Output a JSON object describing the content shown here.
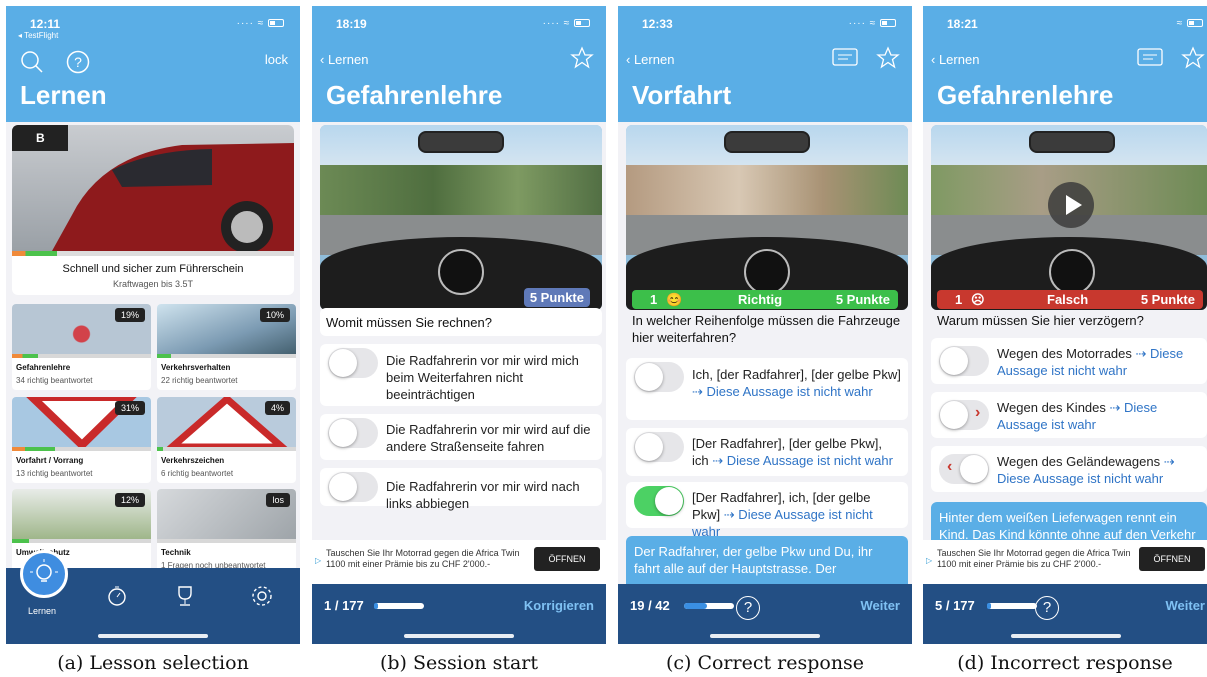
{
  "panels": [
    {
      "caption": "(a) Lesson selection",
      "status": {
        "time": "12:11",
        "sub": "◂ TestFlight"
      },
      "header": {
        "title": "Lernen",
        "lock_label": "lock"
      },
      "hero": {
        "badge": "B",
        "title": "Schnell und sicher zum Führerschein",
        "subtitle": "Kraftwagen bis 3.5T"
      },
      "lessons": [
        {
          "name": "Gefahrenlehre",
          "sub": "34 richtig beantwortet",
          "pct": "19%",
          "progress": 0.19
        },
        {
          "name": "Verkehrsverhalten",
          "sub": "22 richtig beantwortet",
          "pct": "10%",
          "progress": 0.1
        },
        {
          "name": "Vorfahrt / Vorrang",
          "sub": "13 richtig beantwortet",
          "pct": "31%",
          "progress": 0.31
        },
        {
          "name": "Verkehrszeichen",
          "sub": "6 richtig beantwortet",
          "pct": "4%",
          "progress": 0.04
        },
        {
          "name": "Umweltschutz",
          "sub": "",
          "pct": "12%",
          "progress": 0.12
        },
        {
          "name": "Technik",
          "sub": "1 Fragen noch unbeantwortet",
          "pct": "los",
          "progress": 0.0
        }
      ],
      "tabbar": {
        "active_label": "Lernen"
      }
    },
    {
      "caption": "(b) Session start",
      "status": {
        "time": "18:19"
      },
      "header": {
        "back": "Lernen",
        "title": "Gefahrenlehre"
      },
      "points_badge": "5 Punkte",
      "question": "Womit müssen Sie rechnen?",
      "answers": [
        {
          "text": "Die Radfahrerin vor mir wird mich beim Weiterfahren nicht beeinträchtigen",
          "on": false
        },
        {
          "text": "Die Radfahrerin vor mir wird auf die andere Straßenseite fahren",
          "on": false
        },
        {
          "text": "Die Radfahrerin vor mir wird nach links abbiegen",
          "on": false
        }
      ],
      "ad": {
        "text": "Tauschen Sie Ihr Motorrad gegen die Africa Twin 1100 mit einer Prämie bis zu CHF 2'000.-",
        "button": "ÖFFNEN"
      },
      "footer": {
        "counter": "1 / 177",
        "progress": 0.01,
        "action": "Korrigieren"
      }
    },
    {
      "caption": "(c) Correct response",
      "status": {
        "time": "12:33"
      },
      "header": {
        "back": "Lernen",
        "title": "Vorfahrt"
      },
      "result": {
        "count": "1",
        "label": "Richtig",
        "points": "5 Punkte",
        "color": "#3cbf4a"
      },
      "question": "In welcher Reihenfolge müssen die Fahrzeuge hier weiterfahren?",
      "answers": [
        {
          "text": "Ich, [der Radfahrer], [der gelbe Pkw]",
          "link": "⇢ Diese Aussage ist nicht wahr",
          "on": false
        },
        {
          "text": "[Der Radfahrer], [der gelbe Pkw], ich",
          "link": "⇢ Diese Aussage ist nicht wahr",
          "on": false
        },
        {
          "text": "[Der Radfahrer], ich, [der gelbe Pkw]",
          "link": "⇢ Diese Aussage ist nicht wahr",
          "on": true
        }
      ],
      "explanation": "Der Radfahrer, der gelbe Pkw und Du, ihr fahrt alle auf der Hauptstrasse. Der",
      "footer": {
        "counter": "19 / 42",
        "progress": 0.45,
        "action": "Weiter"
      }
    },
    {
      "caption": "(d) Incorrect response",
      "status": {
        "time": "18:21"
      },
      "header": {
        "back": "Lernen",
        "title": "Gefahrenlehre"
      },
      "result": {
        "count": "1",
        "label": "Falsch",
        "points": "5 Punkte",
        "color": "#c8382e"
      },
      "question": "Warum müssen Sie hier verzögern?",
      "answers": [
        {
          "text": "Wegen des Motorrades",
          "link": "⇢ Diese Aussage ist nicht wahr",
          "on": false,
          "arrow": ""
        },
        {
          "text": "Wegen des Kindes",
          "link": "⇢ Diese Aussage ist wahr",
          "on": false,
          "arrow": "›"
        },
        {
          "text": "Wegen des Geländewagens",
          "link": "⇢ Diese Aussage ist nicht wahr",
          "on": false,
          "arrow": "‹"
        }
      ],
      "explanation": "Hinter dem weißen Lieferwagen rennt ein Kind. Das Kind könnte ohne auf den Verkehr",
      "ad": {
        "text": "Tauschen Sie Ihr Motorrad gegen die Africa Twin 1100 mit einer Prämie bis zu CHF 2'000.-",
        "button": "ÖFFNEN"
      },
      "footer": {
        "counter": "5 / 177",
        "progress": 0.03,
        "action": "Weiter"
      }
    }
  ]
}
